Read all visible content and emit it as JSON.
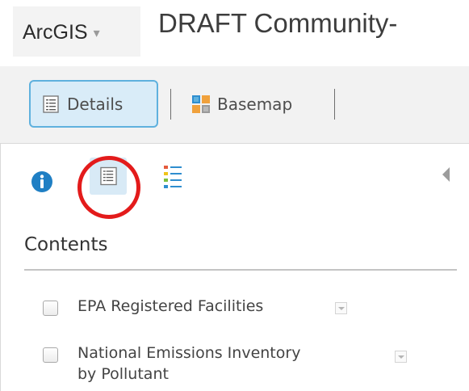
{
  "header": {
    "app_name": "ArcGIS",
    "app_caret": "▾",
    "map_title": "DRAFT Community-"
  },
  "toolbar": {
    "details_label": "Details",
    "basemap_label": "Basemap"
  },
  "details_panel": {
    "tabs": [
      {
        "icon": "info-icon",
        "active": false
      },
      {
        "icon": "content-list-icon",
        "active": true
      },
      {
        "icon": "legend-icon",
        "active": false
      }
    ],
    "heading": "Contents",
    "layers": [
      {
        "label": "EPA Registered Facilities",
        "checked": false
      },
      {
        "label": "National Emissions Inventory",
        "label_line2": "by Pollutant",
        "checked": false
      }
    ]
  },
  "colors": {
    "active_button_bg": "#d9ecf8",
    "active_button_border": "#5fb1de",
    "info_icon": "#1f7fc4",
    "highlight_ring": "#e31b1b"
  }
}
